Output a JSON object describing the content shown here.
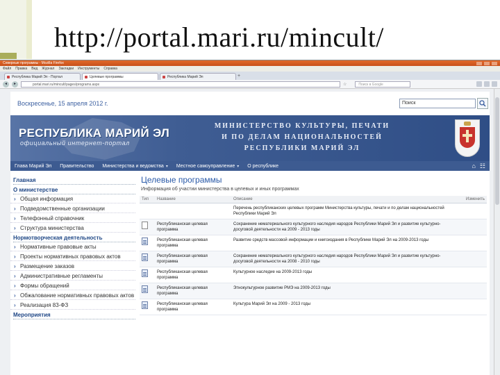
{
  "slide": {
    "title": "http://portal.mari.ru/mincult/"
  },
  "browser": {
    "window_title": "Северные программы - Mozilla Firefox",
    "menu": [
      "Файл",
      "Правка",
      "Вид",
      "Журнал",
      "Закладки",
      "Инструменты",
      "Справка"
    ],
    "tabs": [
      "Республика Марий Эл - Портал",
      "Целевые программы",
      "Республика Марий Эл"
    ],
    "url": "portal.mari.ru/mincult/pages/programs.aspx",
    "web_search_placeholder": "Поиск в Google"
  },
  "page": {
    "date": "Воскресенье, 15 апреля 2012 г.",
    "search_value": "Поиск",
    "banner": {
      "title": "РЕСПУБЛИКА МАРИЙ ЭЛ",
      "subtitle": "официальный интернет-портал",
      "ministry_lines": [
        "МИНИСТЕРСТВО КУЛЬТУРЫ, ПЕЧАТИ",
        "И ПО ДЕЛАМ НАЦИОНАЛЬНОСТЕЙ",
        "РЕСПУБЛИКИ МАРИЙ ЭЛ"
      ]
    },
    "nav": [
      "Глава Марий Эл",
      "Правительство",
      "Министерства и ведомства",
      "Местное самоуправление",
      "О республике"
    ],
    "sidebar": {
      "home": "Главная",
      "section1": "О министерстве",
      "items1": [
        "Общая информация",
        "Подведомственные организации",
        "Телефонный справочник",
        "Структура министерства"
      ],
      "section2": "Нормотворческая деятельность",
      "items2": [
        "Нормативные правовые акты",
        "Проекты нормативных правовых актов",
        "Размещение заказов",
        "Административные регламенты",
        "Формы обращений",
        "Обжалование нормативных правовых актов",
        "Реализация 83-ФЗ"
      ],
      "section3": "Мероприятия"
    },
    "main": {
      "title": "Целевые программы",
      "subtitle": "Информация об участии министерства в целевых и иных программах",
      "columns": [
        "Тип",
        "Название",
        "Описание",
        "Изменить"
      ],
      "rows": [
        {
          "name": "",
          "desc": "Перечень республиканских целевых программ Министерства культуры, печати и по делам национальностей Республики Марий Эл"
        },
        {
          "name": "Республиканская целевая программа",
          "desc": "Сохранение нематериального культурного наследия народов Республики Марий Эл и развитие культурно-досуговой деятельности на 2009 - 2013 годы"
        },
        {
          "name": "Республиканская целевая программа",
          "desc": "Развитие средств массовой информации и книгоиздания в Республике Марий Эл на 2009-2013 годы"
        },
        {
          "name": "Республиканская целевая программа",
          "desc": "Сохранение нематериального культурного наследия народов Республики Марий Эл и развитие культурно-досуговой деятельности на 2008 - 2010 годы"
        },
        {
          "name": "Республиканская целевая программа",
          "desc": "Культурное наследие на 2009-2013 годы"
        },
        {
          "name": "Республиканская целевая программа",
          "desc": "Этнокультурное развитие РМЭ на 2009-2013 годы"
        },
        {
          "name": "Республиканская целевая программа",
          "desc": "Культура Марий Эл на 2009 - 2013 годы"
        }
      ]
    }
  }
}
